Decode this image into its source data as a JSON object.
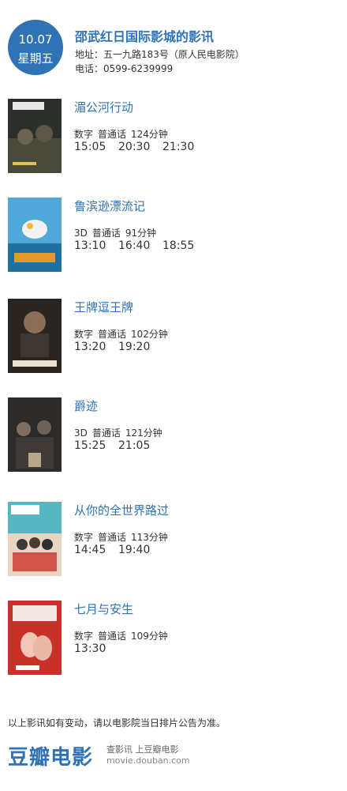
{
  "header": {
    "date": "10.07",
    "weekday": "星期五",
    "cinema_name": "邵武红日国际影城的影讯",
    "address": "地址：五一九路183号（原人民电影院）",
    "phone": "电话：0599-6239999"
  },
  "movies": [
    {
      "title": "湄公河行动",
      "format": "数字",
      "language": "普通话",
      "duration": "124分钟",
      "times": [
        "15:05",
        "20:30",
        "21:30"
      ]
    },
    {
      "title": "鲁滨逊漂流记",
      "format": "3D",
      "language": "普通话",
      "duration": "91分钟",
      "times": [
        "13:10",
        "16:40",
        "18:55"
      ]
    },
    {
      "title": "王牌逗王牌",
      "format": "数字",
      "language": "普通话",
      "duration": "102分钟",
      "times": [
        "13:20",
        "19:20"
      ]
    },
    {
      "title": "爵迹",
      "format": "3D",
      "language": "普通话",
      "duration": "121分钟",
      "times": [
        "15:25",
        "21:05"
      ]
    },
    {
      "title": "从你的全世界路过",
      "format": "数字",
      "language": "普通话",
      "duration": "113分钟",
      "times": [
        "14:45",
        "19:40"
      ]
    },
    {
      "title": "七月与安生",
      "format": "数字",
      "language": "普通话",
      "duration": "109分钟",
      "times": [
        "13:30"
      ]
    }
  ],
  "footer": {
    "note": "以上影讯如有变动，请以电影院当日排片公告为准。",
    "logo": "豆瓣电影",
    "slogan": "查影讯 上豆瓣电影",
    "site": "movie.douban.com"
  },
  "colors": {
    "accent": "#2f72b5"
  }
}
